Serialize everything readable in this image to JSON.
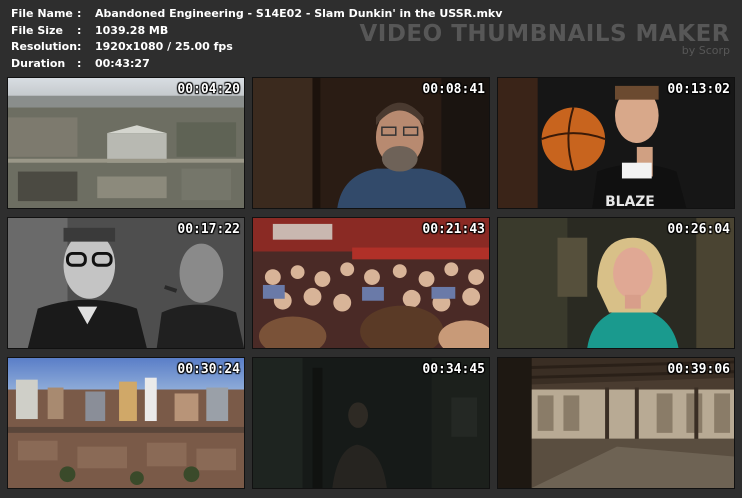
{
  "info": {
    "file_name": {
      "label": "File Name",
      "value": "Abandoned Engineering - S14E02 - Slam Dunkin' in the USSR.mkv"
    },
    "file_size": {
      "label": "File Size",
      "value": "1039.28 MB"
    },
    "resolution": {
      "label": "Resolution",
      "value": "1920x1080 / 25.00 fps"
    },
    "duration": {
      "label": "Duration",
      "value": "00:43:27"
    }
  },
  "brand": {
    "title": "VIDEO THUMBNAILS MAKER",
    "byline": "by Scorp"
  },
  "thumbnails": [
    {
      "time": "00:04:20",
      "scene": "aerial-city-icon"
    },
    {
      "time": "00:08:41",
      "scene": "bearded-man-interview-icon"
    },
    {
      "time": "00:13:02",
      "scene": "basketball-player-icon"
    },
    {
      "time": "00:17:22",
      "scene": "black-white-officials-icon"
    },
    {
      "time": "00:21:43",
      "scene": "crowd-rally-icon"
    },
    {
      "time": "00:26:04",
      "scene": "blonde-woman-interview-icon"
    },
    {
      "time": "00:30:24",
      "scene": "city-skyline-icon"
    },
    {
      "time": "00:34:45",
      "scene": "dark-room-icon"
    },
    {
      "time": "00:39:06",
      "scene": "abandoned-interior-icon"
    }
  ]
}
